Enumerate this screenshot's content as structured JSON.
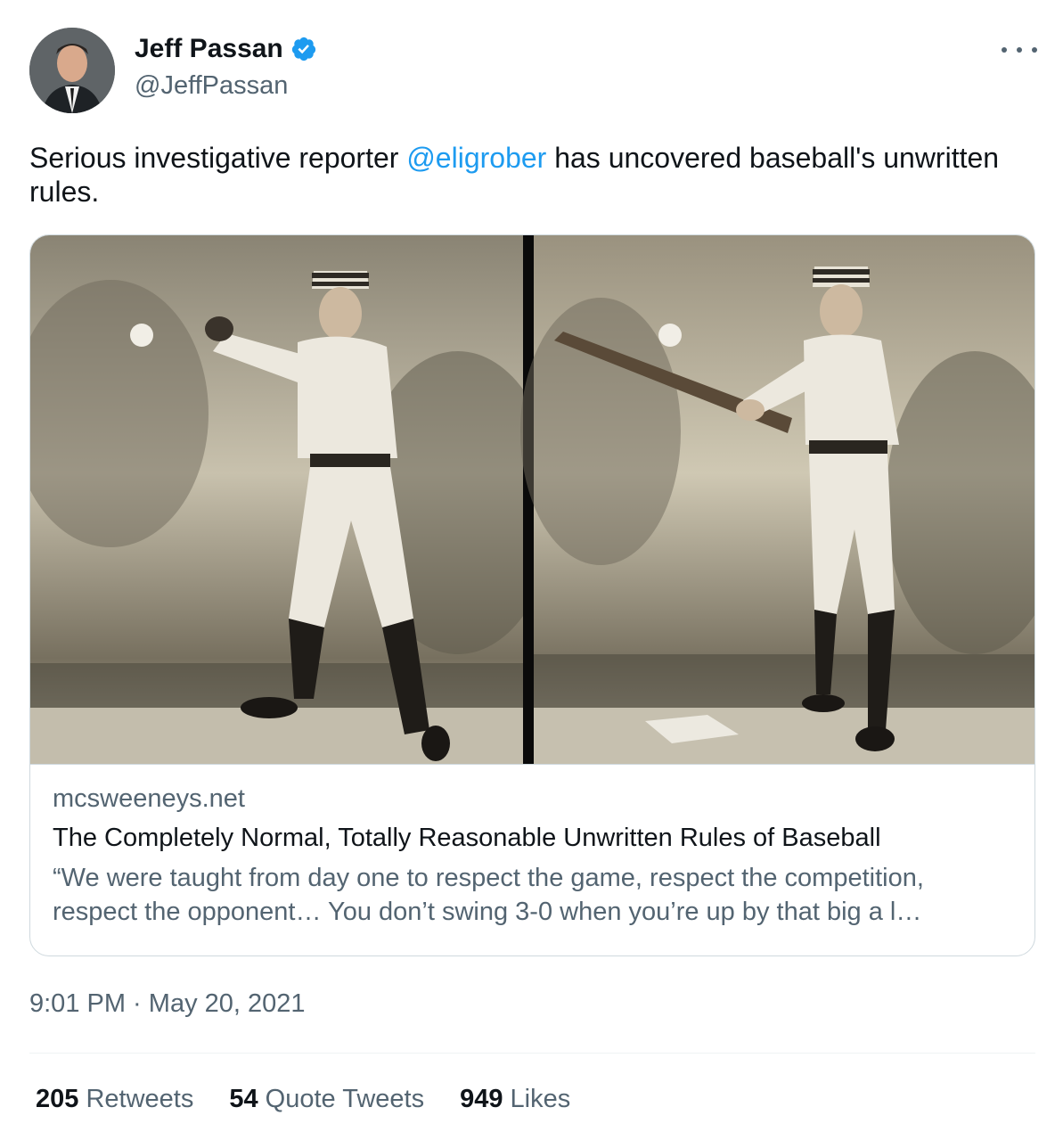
{
  "author": {
    "name": "Jeff Passan",
    "handle": "@JeffPassan",
    "avatar_icon": "profile-photo",
    "verified_icon": "verified-badge-icon",
    "verified_color": "#1d9bf0"
  },
  "more_icon": "more-options-icon",
  "tweet": {
    "text_before": "Serious investigative reporter ",
    "mention": "@eligrober",
    "text_after": " has uncovered baseball's unwritten rules."
  },
  "card": {
    "domain": "mcsweeneys.net",
    "title": "The Completely Normal, Totally Reasonable Unwritten Rules of Baseball",
    "description": "“We were taught from day one to respect the game, respect the competition, respect the opponent… You don’t swing 3-0 when you’re up by that big a l…"
  },
  "timestamp": {
    "time": "9:01 PM",
    "separator": " · ",
    "date": "May 20, 2021"
  },
  "stats": [
    {
      "count": "205",
      "label": "Retweets"
    },
    {
      "count": "54",
      "label": "Quote Tweets"
    },
    {
      "count": "949",
      "label": "Likes"
    }
  ],
  "colors": {
    "text": "#0f1419",
    "secondary": "#536471",
    "link": "#1d9bf0",
    "border": "#cfd9de"
  }
}
